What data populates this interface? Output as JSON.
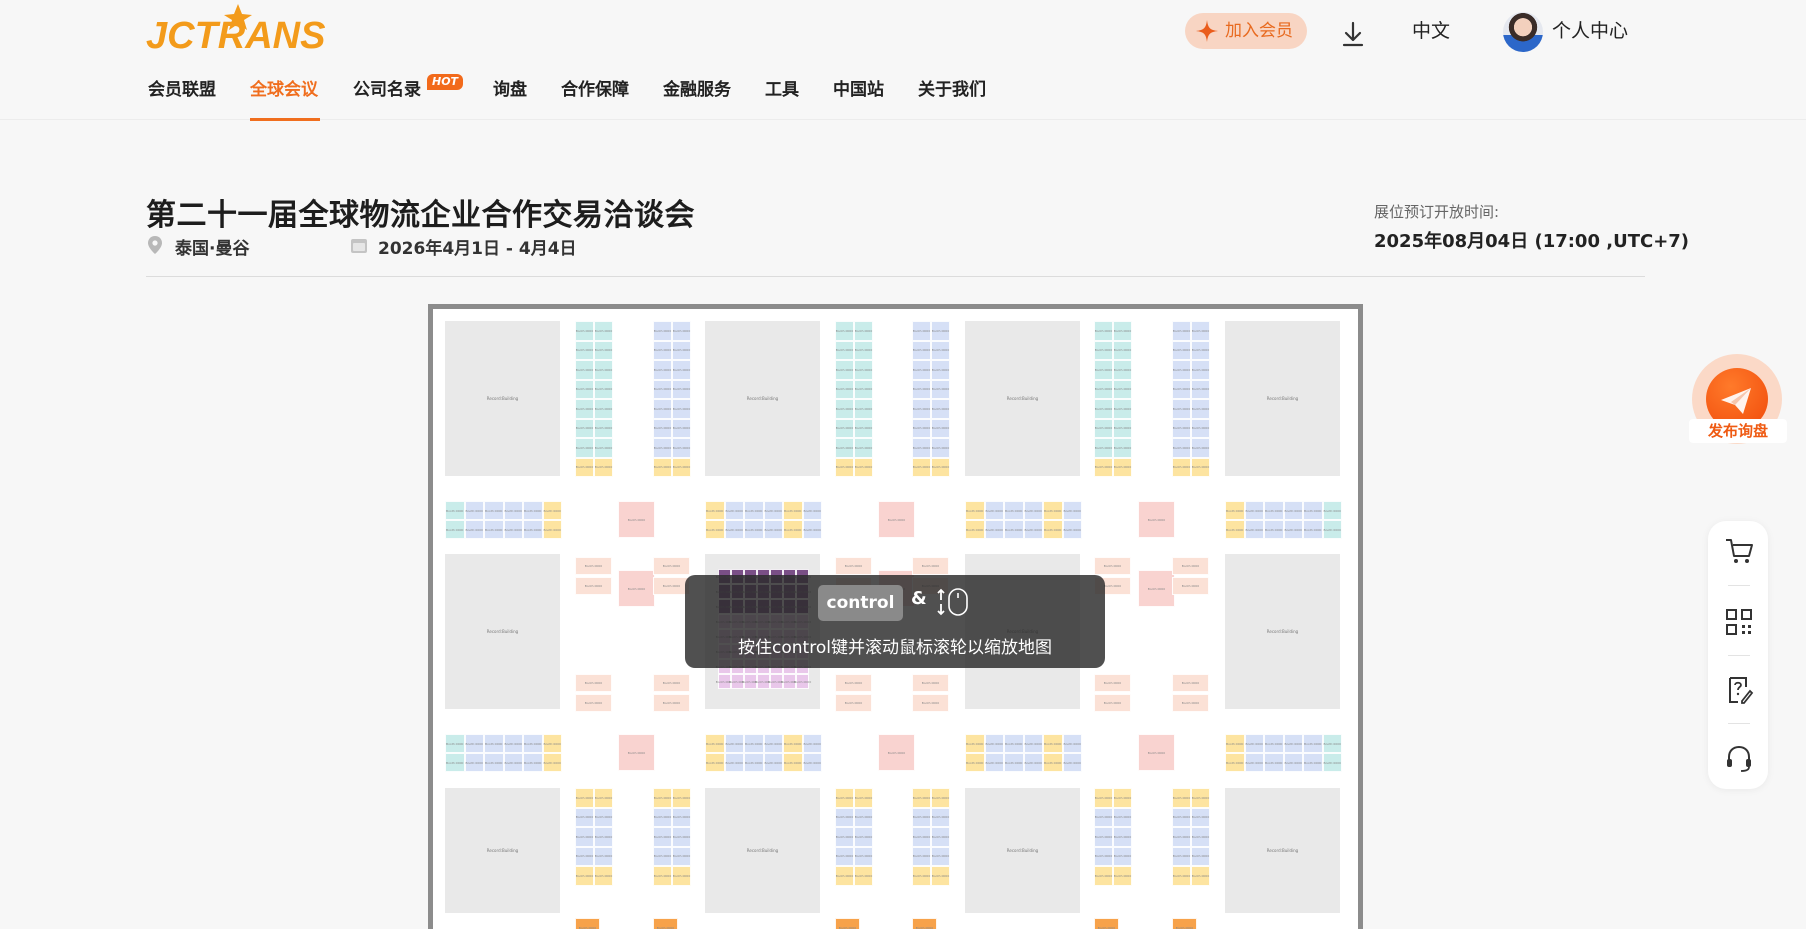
{
  "header": {
    "logo_text": "JCTRANS",
    "join_label": "加入会员",
    "language": "中文",
    "user_center": "个人中心"
  },
  "nav": {
    "items": [
      {
        "label": "会员联盟"
      },
      {
        "label": "全球会议"
      },
      {
        "label": "公司名录"
      },
      {
        "label": "询盘"
      },
      {
        "label": "合作保障"
      },
      {
        "label": "金融服务"
      },
      {
        "label": "工具"
      },
      {
        "label": "中国站"
      },
      {
        "label": "关于我们"
      }
    ],
    "hot_badge": "HOT",
    "active_index": 1
  },
  "event": {
    "title": "第二十一届全球物流企业合作交易洽谈会",
    "location": "泰国·曼谷",
    "date": "2026年4月1日 - 4月4日",
    "open_label": "展位预订开放时间:",
    "open_time": "2025年08月04日 (17:00 ,UTC+7)"
  },
  "floor_map": {
    "hall_label": "Record:Building",
    "booth_label": "Booth:0000"
  },
  "zoom_tip": {
    "key": "control",
    "amp": "&",
    "text": "按住control键并滚动鼠标滚轮以缩放地图"
  },
  "side": {
    "publish_label": "发布询盘",
    "tools": [
      "cart-icon",
      "qrcode-icon",
      "help-icon",
      "headset-icon"
    ]
  },
  "colors": {
    "brand": "#f06e1e",
    "booth_blue": "#d6e0f6",
    "booth_cyan": "#c9ecea",
    "booth_yellow": "#fde4a0",
    "booth_pink": "#f9d3d0",
    "booth_peach": "#fbe1d6",
    "booth_purple": "#e9c7ea",
    "booth_orange": "#f7a24a"
  }
}
